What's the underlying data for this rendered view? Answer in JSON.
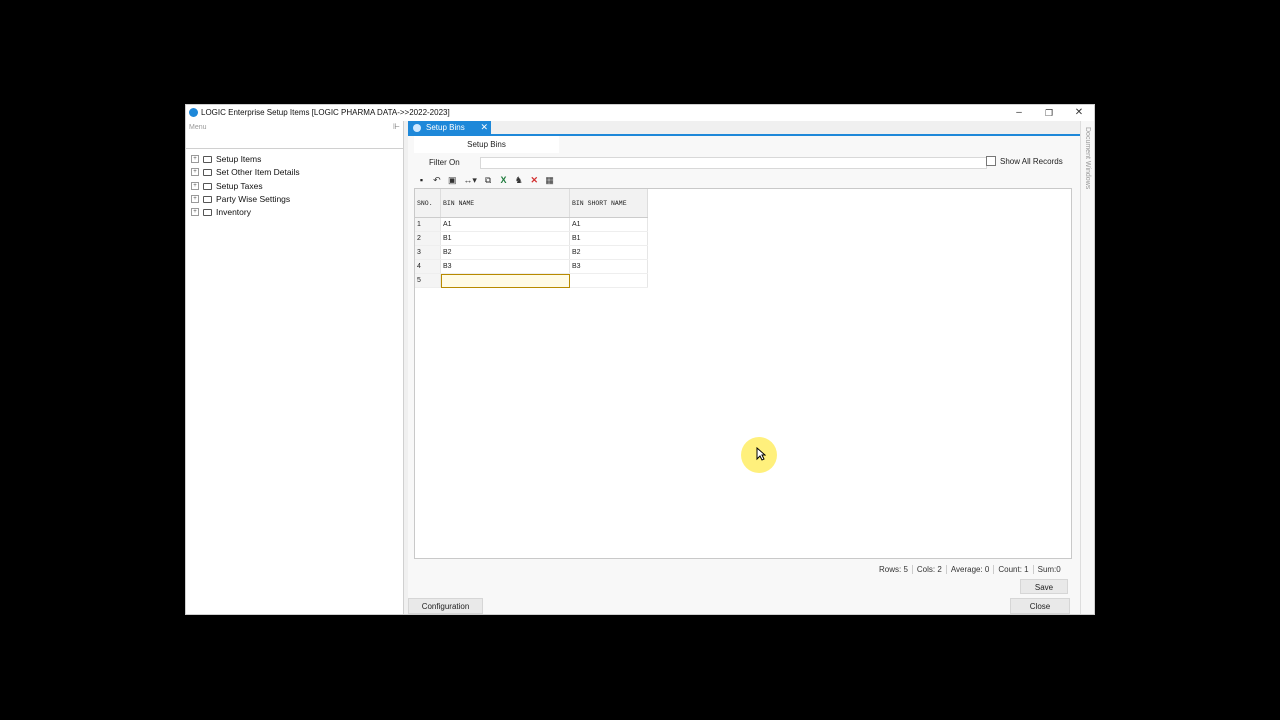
{
  "window": {
    "title": "LOGIC Enterprise Setup Items  [LOGIC PHARMA DATA->>2022-2023]",
    "controls": {
      "minimize": "–",
      "maximize": "❐",
      "close": "✕"
    }
  },
  "menu": {
    "header": "Menu",
    "items": [
      {
        "label": "Setup Items"
      },
      {
        "label": "Set Other Item Details"
      },
      {
        "label": "Setup Taxes"
      },
      {
        "label": "Party Wise Settings"
      },
      {
        "label": "Inventory"
      }
    ]
  },
  "document_tab": {
    "label": "Setup Bins"
  },
  "side_strip": {
    "label": "Document Windows"
  },
  "subtab": {
    "label": "Setup Bins"
  },
  "filter": {
    "label": "Filter On",
    "value": "",
    "show_all_label": "Show All Records",
    "show_all_checked": false
  },
  "grid": {
    "columns": [
      "SNO.",
      "BIN NAME",
      "BIN SHORT NAME"
    ],
    "rows": [
      {
        "sno": "1",
        "name": "A1",
        "short": "A1"
      },
      {
        "sno": "2",
        "name": "B1",
        "short": "B1"
      },
      {
        "sno": "3",
        "name": "B2",
        "short": "B2"
      },
      {
        "sno": "4",
        "name": "B3",
        "short": "B3"
      },
      {
        "sno": "5",
        "name": "",
        "short": ""
      }
    ]
  },
  "status": {
    "rows": "Rows: 5",
    "cols": "Cols: 2",
    "average": "Average: 0",
    "count": "Count: 1",
    "sum": "Sum:0"
  },
  "buttons": {
    "save": "Save",
    "configuration": "Configuration",
    "close": "Close"
  },
  "colors": {
    "accent": "#1e88d9",
    "edit_cell_bg": "#fffbe6",
    "cursor_highlight": "#ffeb50"
  }
}
